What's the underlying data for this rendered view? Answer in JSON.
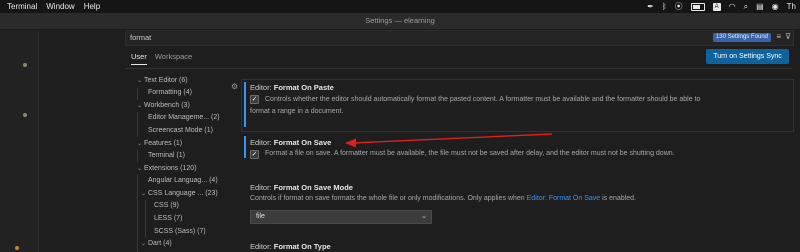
{
  "menubar": {
    "items": [
      "Terminal",
      "Window",
      "Help"
    ],
    "tray_initials": "Th"
  },
  "window": {
    "title": "Settings — elearning"
  },
  "search": {
    "value": "format",
    "results_badge": "130 Settings Found"
  },
  "scope_tabs": [
    "User",
    "Workspace"
  ],
  "sync_button": "Turn on Settings Sync",
  "toc": [
    {
      "label": "Text Editor (6)"
    },
    {
      "label": "Formatting (4)"
    },
    {
      "label": "Workbench (3)"
    },
    {
      "label": "Editor Manageme... (2)"
    },
    {
      "label": "Screencast Mode (1)"
    },
    {
      "label": "Features (1)"
    },
    {
      "label": "Terminal (1)"
    },
    {
      "label": "Extensions (120)"
    },
    {
      "label": "Angular Languag... (4)"
    },
    {
      "label": "CSS Language ... (23)"
    },
    {
      "label": "CSS (9)"
    },
    {
      "label": "LESS (7)"
    },
    {
      "label": "SCSS (Sass) (7)"
    },
    {
      "label": "Dart (4)"
    }
  ],
  "settings": {
    "format_on_paste": {
      "category": "Editor: ",
      "name": "Format On Paste",
      "desc_line1": "Controls whether the editor should automatically format the pasted content. A formatter must be available and the formatter should be able to",
      "desc_line2": "format a range in a document.",
      "checked": true
    },
    "format_on_save": {
      "category": "Editor: ",
      "name": "Format On Save",
      "desc": "Format a file on save. A formatter must be available, the file must not be saved after delay, and the editor must not be shutting down.",
      "checked": true
    },
    "format_on_save_mode": {
      "category": "Editor: ",
      "name": "Format On Save Mode",
      "desc_before": "Controls if format on save formats the whole file or only modifications. Only applies when ",
      "desc_link": "Editor: Format On Save",
      "desc_after": " is enabled.",
      "value": "file"
    },
    "format_on_type": {
      "category": "Editor: ",
      "name": "Format On Type"
    }
  },
  "colors": {
    "accent": "#3794ff",
    "annotation_arrow": "#e02020",
    "sync_button": "#0e639c"
  }
}
